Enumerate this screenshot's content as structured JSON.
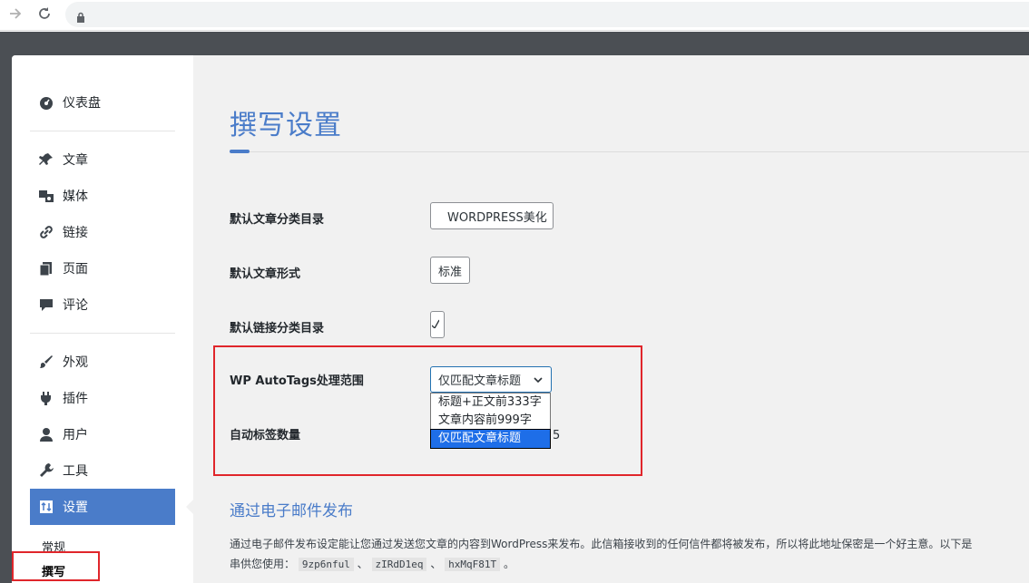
{
  "browser": {
    "forward_icon": "arrow-right-icon",
    "reload_icon": "reload-icon",
    "lock_icon": "lock-icon"
  },
  "sidebar": {
    "items": [
      {
        "label": "仪表盘",
        "icon": "dashboard-icon"
      },
      {
        "label": "文章",
        "icon": "pin-icon"
      },
      {
        "label": "媒体",
        "icon": "media-icon"
      },
      {
        "label": "链接",
        "icon": "link-icon"
      },
      {
        "label": "页面",
        "icon": "pages-icon"
      },
      {
        "label": "评论",
        "icon": "comment-icon"
      },
      {
        "label": "外观",
        "icon": "brush-icon"
      },
      {
        "label": "插件",
        "icon": "plugin-icon"
      },
      {
        "label": "用户",
        "icon": "user-icon"
      },
      {
        "label": "工具",
        "icon": "wrench-icon"
      }
    ],
    "active": {
      "label": "设置",
      "icon": "settings-icon"
    },
    "submenu": [
      "常规",
      "撰写"
    ]
  },
  "main": {
    "title": "撰写设置",
    "rows": [
      {
        "label": "默认文章分类目录",
        "value": "WORDPRESS美化"
      },
      {
        "label": "默认文章形式",
        "value": "标准"
      },
      {
        "label": "默认链接分类目录",
        "value": ""
      },
      {
        "label": "WP AutoTags处理范围",
        "value": "仅匹配文章标题"
      },
      {
        "label": "自动标签数量",
        "value": "5"
      }
    ],
    "dropdown_options": [
      "标题+正文前333字",
      "文章内容前999字",
      "仅匹配文章标题"
    ],
    "email_section": {
      "title": "通过电子邮件发布",
      "desc_line1": "通过电子邮件发布设定能让您通过发送您文章的内容到WordPress来发布。此信箱接收到的任何信件都将被发布，所以将此地址保密是一个好主意。以下是",
      "desc_prefix": "串供您使用：",
      "codes": [
        "9zp6nful",
        "zIRdD1eq",
        "hxMqF81T"
      ],
      "sep": "、",
      "end": "。"
    }
  },
  "colors": {
    "accent": "#4a7cc9",
    "highlight": "#e0262b",
    "selected_option": "#1e6ee8"
  }
}
